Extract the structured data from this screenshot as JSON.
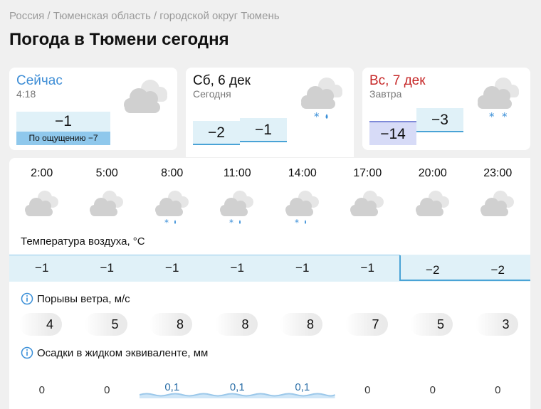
{
  "breadcrumb": "Россия / Тюменская область / городской округ Тюмень",
  "page_title": "Погода в Тюмени сегодня",
  "now_card": {
    "title": "Сейчас",
    "time": "4:18",
    "temp": "−1",
    "feels_like": "По ощущению −7",
    "icon": "cloudy-icon"
  },
  "today_card": {
    "title": "Сб, 6 дек",
    "subtitle": "Сегодня",
    "temp_min": "−2",
    "temp_max": "−1",
    "icon": "cloudy-snow-rain-icon"
  },
  "tomorrow_card": {
    "title": "Вс, 7 дек",
    "subtitle": "Завтра",
    "temp_min": "−14",
    "temp_max": "−3",
    "icon": "cloudy-snow-icon"
  },
  "hours": [
    "2:00",
    "5:00",
    "8:00",
    "11:00",
    "14:00",
    "17:00",
    "20:00",
    "23:00"
  ],
  "hour_icons": [
    "cloudy-icon",
    "cloudy-icon",
    "cloudy-snow-rain-icon",
    "cloudy-snow-rain-icon",
    "cloudy-snow-rain-icon",
    "cloudy-icon",
    "cloudy-icon",
    "cloudy-icon"
  ],
  "temperature": {
    "title": "Температура воздуха, °C",
    "values": [
      "−1",
      "−1",
      "−1",
      "−1",
      "−1",
      "−1",
      "−2",
      "−2"
    ]
  },
  "wind": {
    "title": "Порывы ветра, м/с",
    "values": [
      "4",
      "5",
      "8",
      "8",
      "8",
      "7",
      "5",
      "3"
    ]
  },
  "precip": {
    "title": "Осадки в жидком эквиваленте, мм",
    "values": [
      "0",
      "0",
      "0,1",
      "0,1",
      "0,1",
      "0",
      "0",
      "0"
    ]
  },
  "colors": {
    "now_title": "#3f8ed6",
    "tomorrow_title": "#c62828",
    "temp_fill": "#e0f1f8",
    "temp_line": "#4aa3d6",
    "cold_fill": "#d7dbf7",
    "feels_fill": "#8fc8ec",
    "precip_wave": "#9cc8ea",
    "snowflake": "#3a8fd8"
  }
}
